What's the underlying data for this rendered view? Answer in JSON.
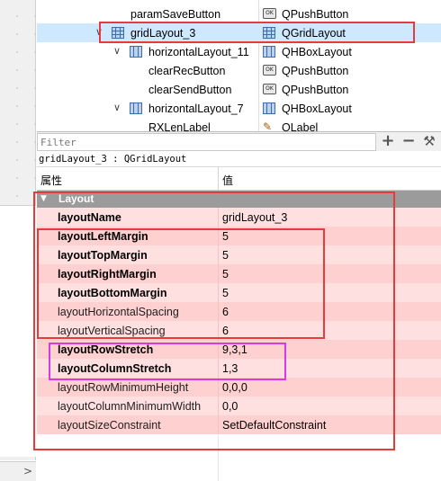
{
  "tree": {
    "rows": [
      {
        "name": "paramSaveButton",
        "class": "QPushButton",
        "icon": "pushbutton-icon"
      },
      {
        "name": "gridLayout_3",
        "class": "QGridLayout",
        "icon": "grid-layout-icon",
        "selected": true
      },
      {
        "name": "horizontalLayout_11",
        "class": "QHBoxLayout",
        "icon": "hbox-layout-icon"
      },
      {
        "name": "clearRecButton",
        "class": "QPushButton",
        "icon": "pushbutton-icon"
      },
      {
        "name": "clearSendButton",
        "class": "QPushButton",
        "icon": "pushbutton-icon"
      },
      {
        "name": "horizontalLayout_7",
        "class": "QHBoxLayout",
        "icon": "hbox-layout-icon"
      },
      {
        "name": "RXLenLabel",
        "class": "QLabel",
        "icon": "label-icon"
      }
    ]
  },
  "filter": {
    "placeholder": "Filter",
    "add": "+",
    "remove": "−",
    "configure": "⚒"
  },
  "object_line": "gridLayout_3 : QGridLayout",
  "property_editor": {
    "header_property": "属性",
    "header_value": "值",
    "group": "Layout",
    "properties": [
      {
        "name": "layoutName",
        "value": "gridLayout_3",
        "bold": true
      },
      {
        "name": "layoutLeftMargin",
        "value": "5",
        "bold": true
      },
      {
        "name": "layoutTopMargin",
        "value": "5",
        "bold": true
      },
      {
        "name": "layoutRightMargin",
        "value": "5",
        "bold": true
      },
      {
        "name": "layoutBottomMargin",
        "value": "5",
        "bold": true
      },
      {
        "name": "layoutHorizontalSpacing",
        "value": "6",
        "bold": false
      },
      {
        "name": "layoutVerticalSpacing",
        "value": "6",
        "bold": false
      },
      {
        "name": "layoutRowStretch",
        "value": "9,3,1",
        "bold": true
      },
      {
        "name": "layoutColumnStretch",
        "value": "1,3",
        "bold": true
      },
      {
        "name": "layoutRowMinimumHeight",
        "value": "0,0,0",
        "bold": false
      },
      {
        "name": "layoutColumnMinimumWidth",
        "value": "0,0",
        "bold": false
      },
      {
        "name": "layoutSizeConstraint",
        "value": "SetDefaultConstraint",
        "bold": false
      }
    ]
  },
  "colors": {
    "annotation_red": "#e8393b",
    "annotation_magenta": "#d63ae0",
    "row_light": "#ffe0e0",
    "row_dark": "#ffd0d0",
    "group_bg": "#9b9b9b",
    "selected_bg": "#cde8ff"
  }
}
